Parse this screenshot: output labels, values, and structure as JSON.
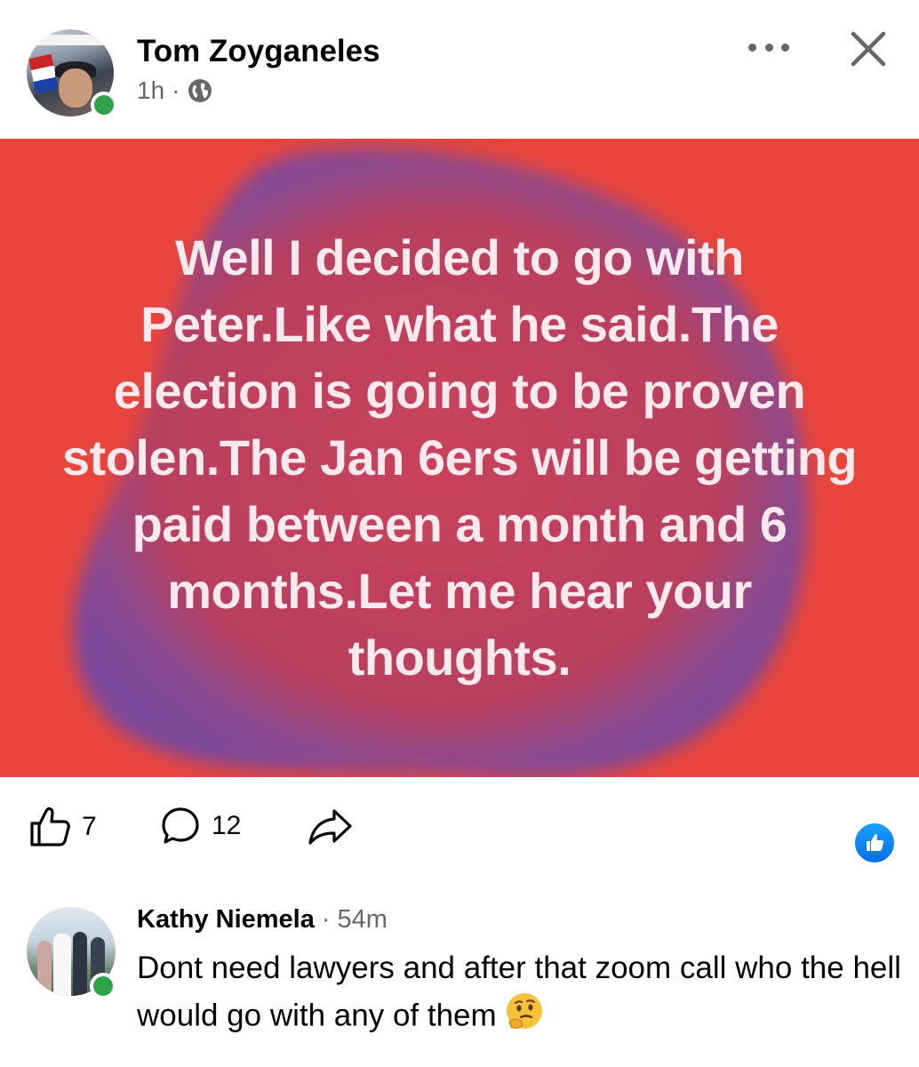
{
  "post": {
    "author_name": "Tom Zoyganeles",
    "time": "1h",
    "separator": "·",
    "text": "Well I decided to go with Peter.Like what he said.The election is going to be proven stolen.The Jan 6ers will be getting paid between a month and 6 months.Let me hear your thoughts.",
    "background_color": "#e8453c",
    "blob_color": "#7a4a9a",
    "text_color": "#fbe9ee"
  },
  "actions": {
    "like_count": "7",
    "comment_count": "12"
  },
  "comment": {
    "author_name": "Kathy Niemela",
    "separator": "·",
    "time": "54m",
    "text": "Dont need lawyers and after that zoom call who the hell would go with any of them",
    "emoji": "thinking-face"
  },
  "colors": {
    "online": "#31a24c",
    "meta": "#65676b",
    "like_blue": "#0a6fe6"
  }
}
